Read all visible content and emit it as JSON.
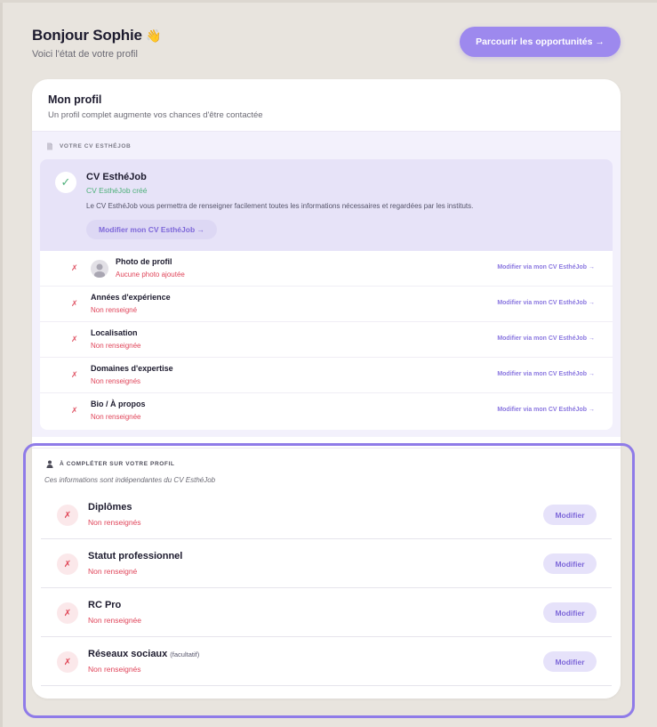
{
  "header": {
    "greeting": "Bonjour Sophie",
    "wave_emoji": "👋",
    "subtitle": "Voici l'état de votre profil",
    "cta_label": "Parcourir les opportunités →"
  },
  "profile_card": {
    "title": "Mon profil",
    "subtitle": "Un profil complet augmente vos chances d'être contactée"
  },
  "cv_section": {
    "label": "VOTRE CV ESTHÉJOB",
    "icon": "document-icon",
    "title": "CV EsthéJob",
    "status": "CV EsthéJob créé",
    "description": "Le CV EsthéJob vous permettra de renseigner facilement toutes les informations nécessaires et regardées par les instituts.",
    "edit_label": "Modifier mon CV EsthéJob →",
    "items": [
      {
        "title": "Photo de profil",
        "status": "Aucune photo ajoutée",
        "link": "Modifier via mon CV EsthéJob →",
        "mark": "✗"
      },
      {
        "title": "Années d'expérience",
        "status": "Non renseigné",
        "link": "Modifier via mon CV EsthéJob →",
        "mark": "✗"
      },
      {
        "title": "Localisation",
        "status": "Non renseignée",
        "link": "Modifier via mon CV EsthéJob →",
        "mark": "✗"
      },
      {
        "title": "Domaines d'expertise",
        "status": "Non renseignés",
        "link": "Modifier via mon CV EsthéJob →",
        "mark": "✗"
      },
      {
        "title": "Bio / À propos",
        "status": "Non renseignée",
        "link": "Modifier via mon CV EsthéJob →",
        "mark": "✗"
      }
    ]
  },
  "complete_section": {
    "label": "À COMPLÉTER SUR VOTRE PROFIL",
    "icon": "person-icon",
    "note": "Ces informations sont indépendantes du CV EsthéJob",
    "items": [
      {
        "title": "Diplômes",
        "optional": "",
        "status": "Non renseignés",
        "button": "Modifier",
        "mark": "✗"
      },
      {
        "title": "Statut professionnel",
        "optional": "",
        "status": "Non renseigné",
        "button": "Modifier",
        "mark": "✗"
      },
      {
        "title": "RC Pro",
        "optional": "",
        "status": "Non renseignée",
        "button": "Modifier",
        "mark": "✗"
      },
      {
        "title": "Réseaux sociaux",
        "optional": "(facultatif)",
        "status": "Non renseignés",
        "button": "Modifier",
        "mark": "✗"
      }
    ]
  },
  "colors": {
    "accent": "#9d89ee",
    "success": "#4fb07b",
    "error": "#e0455a",
    "background": "#e8e4de"
  }
}
